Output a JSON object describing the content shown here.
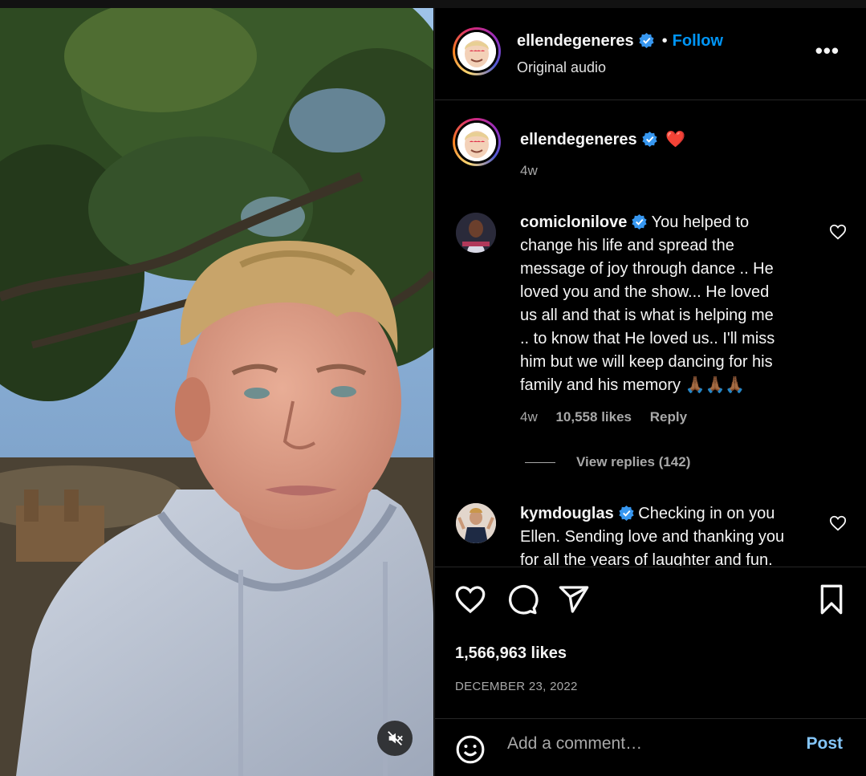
{
  "post": {
    "author": "ellendegeneres",
    "follow_label": "Follow",
    "audio": "Original audio",
    "more_label": "•••",
    "caption_emoji": "❤️",
    "caption_time": "4w",
    "likes": "1,566,963 likes",
    "date": "DECEMBER 23, 2022"
  },
  "comments": [
    {
      "user": "comiclonilove",
      "text": "You helped to change his life and spread the message of joy through dance .. He loved you and the show... He loved us all and that is what is helping me .. to know that He loved us.. I'll miss him but we will keep dancing for his family and his memory 🙏🏾🙏🏾🙏🏾",
      "line1": "You helped to",
      "lines": [
        "change his life and spread the",
        "message of joy through dance .. He",
        "loved you and the show... He loved",
        "us all and that is what is helping me",
        ".. to know that He loved us.. I'll miss",
        "him but we will keep dancing for his",
        "family and his memory 🙏🏾🙏🏾🙏🏾"
      ],
      "time": "4w",
      "likes": "10,558 likes",
      "reply": "Reply",
      "view_replies": "View replies (142)"
    },
    {
      "user": "kymdouglas",
      "line1": "Checking in on you",
      "lines": [
        "Ellen. Sending love and thanking you",
        "for all the years of laughter and fun."
      ]
    }
  ],
  "composer": {
    "placeholder": "Add a comment…",
    "post_label": "Post"
  },
  "icons": [
    "verified-badge-icon",
    "more-icon",
    "heart-icon",
    "comment-icon",
    "share-icon",
    "bookmark-icon",
    "emoji-icon",
    "mute-icon"
  ],
  "colors": {
    "accent": "#0095f6",
    "post_button": "#84c5f8",
    "background": "#000000",
    "verified": "#3797f0"
  }
}
